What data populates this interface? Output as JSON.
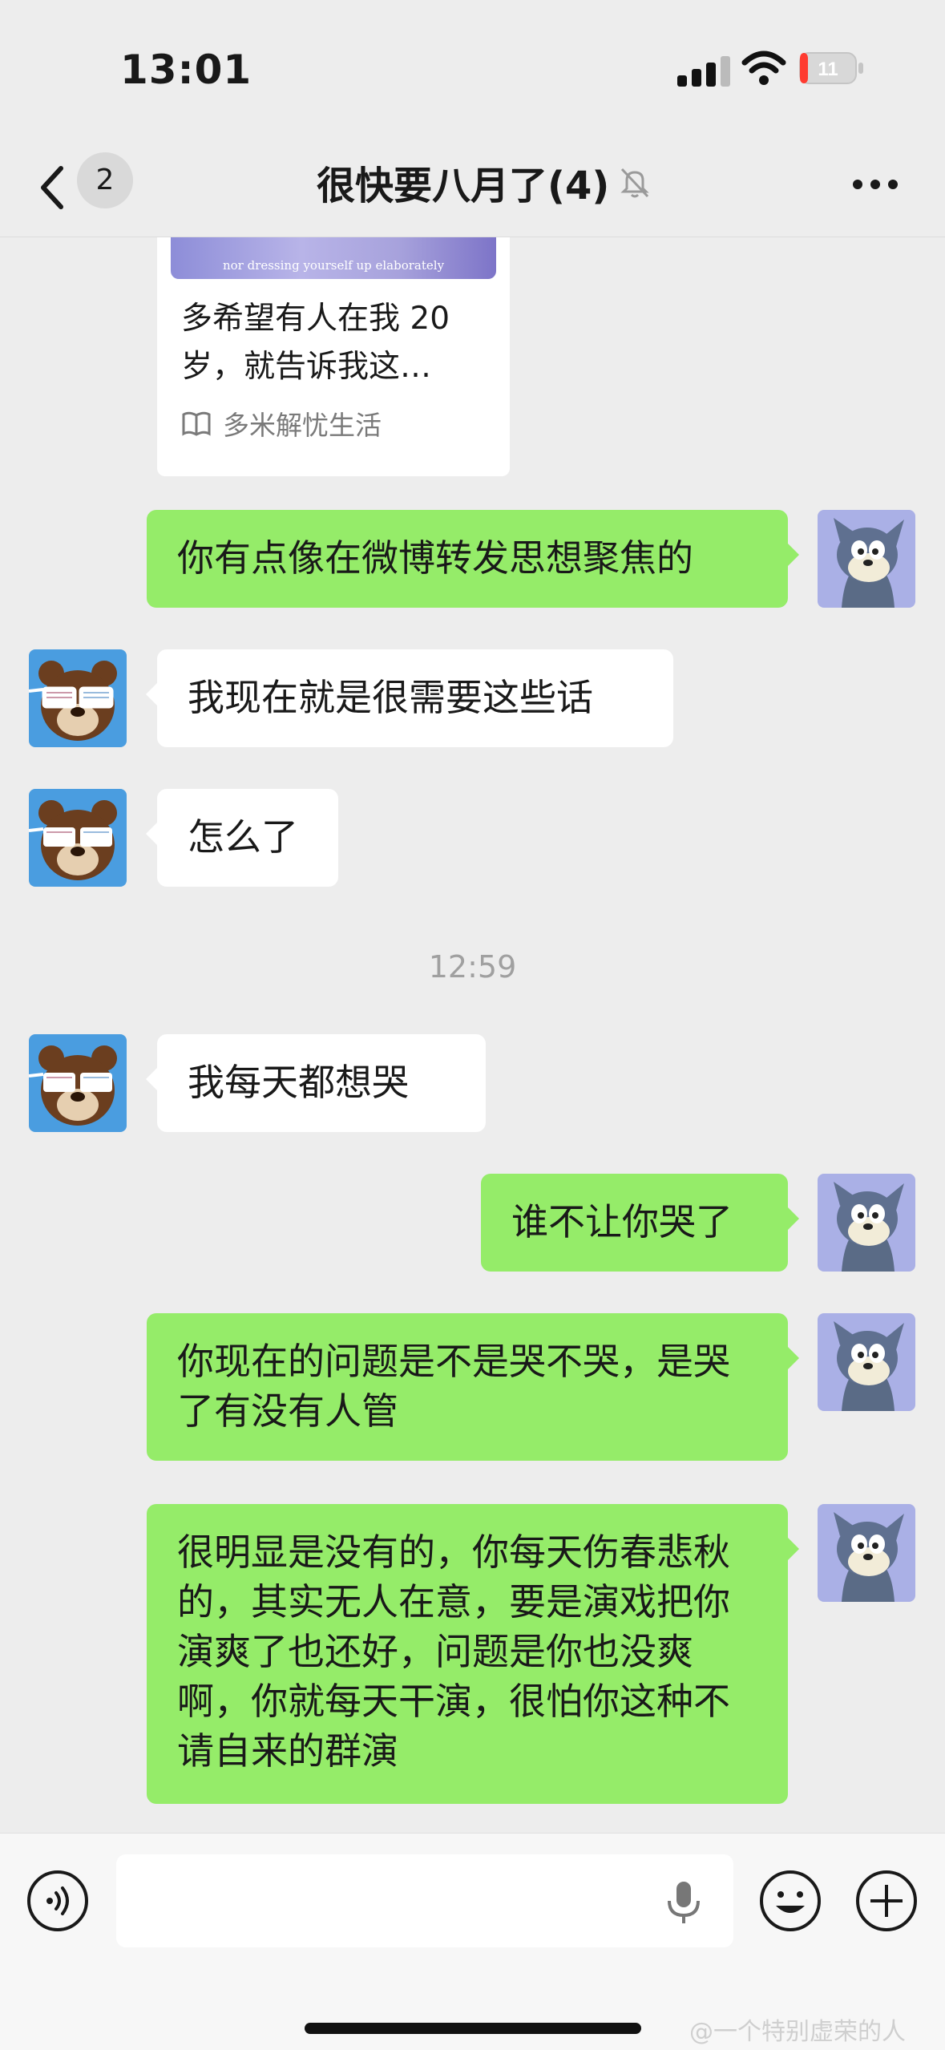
{
  "status_bar": {
    "time": "13:01",
    "battery": "11"
  },
  "nav": {
    "back_count": "2",
    "title": "很快要八月了(4)"
  },
  "card": {
    "image_caption": "nor dressing yourself up elaborately",
    "text": "多希望有人在我 20 岁，就告诉我这…",
    "source": "多米解忧生活"
  },
  "messages": [
    {
      "side": "right",
      "text": "你有点像在微博转发思想聚焦的"
    },
    {
      "side": "left",
      "text": "我现在就是很需要这些话"
    },
    {
      "side": "left",
      "text": "怎么了"
    },
    {
      "side": "left",
      "text": "我每天都想哭"
    },
    {
      "side": "right",
      "text": "谁不让你哭了"
    },
    {
      "side": "right",
      "text": "你现在的问题是不是哭不哭，是哭了有没有人管"
    },
    {
      "side": "right",
      "text": "很明显是没有的，你每天伤春悲秋的，其实无人在意，要是演戏把你演爽了也还好，问题是你也没爽啊，你就每天干演，很怕你这种不请自来的群演"
    }
  ],
  "timestamp": "12:59",
  "watermark": "@一个特别虚荣的人",
  "icons": [
    "back-chevron-icon",
    "mute-bell-icon",
    "more-dots-icon",
    "voice-icon",
    "mic-icon",
    "emoji-icon",
    "plus-icon",
    "book-icon"
  ],
  "colors": {
    "bubble_self": "#95ec69",
    "bubble_other": "#ffffff",
    "background": "#ededed"
  }
}
